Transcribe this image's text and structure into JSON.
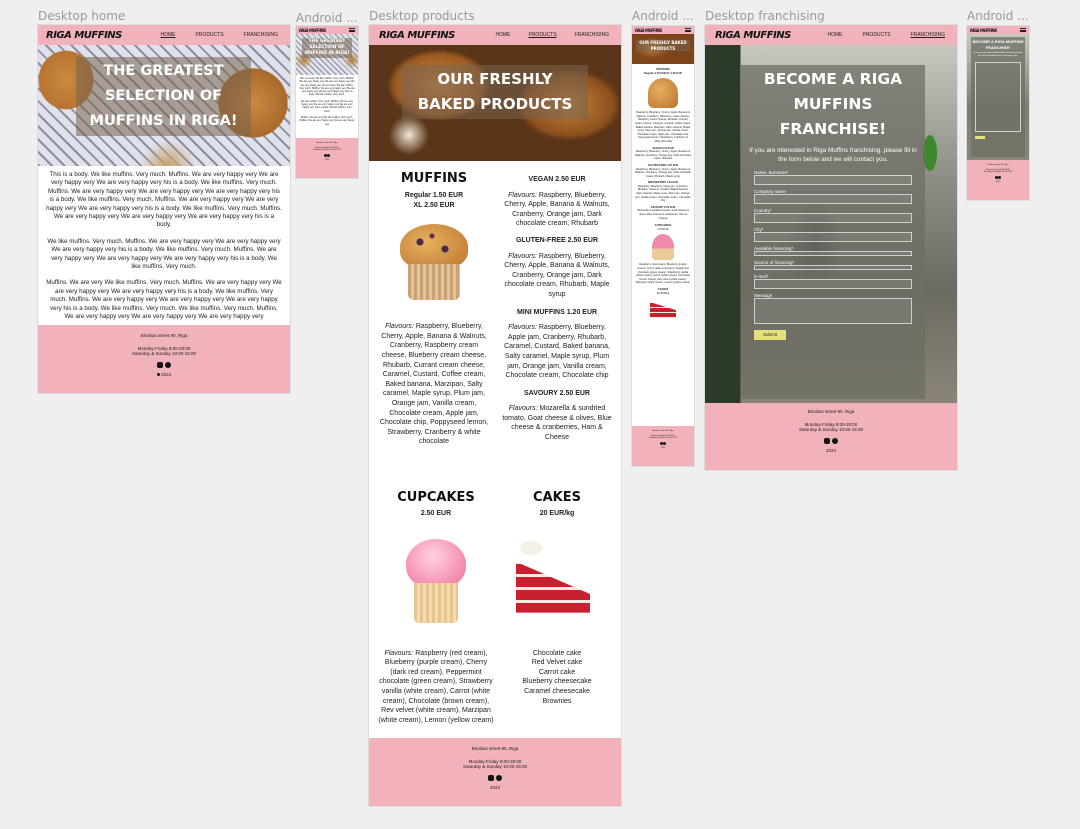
{
  "brand": "RIGA MUFFINS",
  "frames": {
    "desktop_home": "Desktop home",
    "android_home": "Android ...",
    "desktop_products": "Desktop products",
    "android_products": "Android ...",
    "desktop_franchising": "Desktop franchising",
    "android_franchising": "Android ..."
  },
  "nav": {
    "home": "HOME",
    "products": "PRODUCTS",
    "franchising": "FRANCHISING"
  },
  "home": {
    "hero_title": "THE GREATEST SELECTION OF MUFFINS IN RIGA!",
    "mobile_hero_title": "THE GREATEST SELECTION OF MUFFINS IN RIGA!",
    "p1": "This is a body. We like muffins. Very much. Muffins. We are very happy very We are very happy very We are very happy very   his is a body. We like muffins. Very much. Muffins. We are very happy very We are very happy very We are very happy very   his is a body. We like muffins. Very much. Muffins. We are very happy very We are very happy very We are very happy very   his is a body. We like muffins. Very much. Muffins. We are very happy very We are very happy very We are very happy very   his is a body.",
    "p2": "We like muffins. Very much. Muffins. We are very happy very We are very happy very We are very happy very   his is a body. We like muffins. Very much. Muffins. We are very happy very We are very happy very We are very happy very   his is a body. We like muffins. Very much.",
    "p3": "Muffins. We are very We like muffins. Very much. Muffins. We are very happy very We are very happy very We are very happy very   his is a body. We like muffins. Very much. Muffins. We are very happy very We are very happy very We are very happy very   his is a body. We like muffins. Very much. We like muffins. Very much. Muffins. We are very happy very We are very happy very We are very happy very",
    "m_p1": "This is a body. We like muffins. Very much. Muffins. We are very happy very We are very happy very We are very happy very   his is a body. We like muffins. Very much. Muffins. We are very happy very We are very happy very We are very happy very   his is a body. We like muffins. Very much.",
    "m_p2": "We like muffins. Very much. Muffins. We are very happy very We are very happy very We are very happy very   his is a body. We like muffins. Very much.",
    "m_p3": "Muffins. We are very We like muffins. Very much. Muffins. We are very happy very We are very happy very"
  },
  "footer": {
    "address": "Brivibas street 90, Riga",
    "hours1": "Monday-Friday 8:00-20:00",
    "hours2": "Saturday & Sunday 10:00-15:00",
    "copyright": "2023"
  },
  "products": {
    "hero_title": "OUR FRESHLY BAKED PRODUCTS",
    "muffins": {
      "title": "MUFFINS",
      "price1": "Regular 1.50 EUR",
      "price2": "XL 2.50 EUR",
      "flavours_label": "Flavours:",
      "flavours": "Raspberry, Blueberry, Cherry, Apple, Banana & Walnuts, Cranberry, Raspberry cream cheese, Blueberry cream cheese, Rhubarb, Currant cream cheese, Caramel, Custard, Coffee cream, Baked banana, Marzipan, Salty caramel, Maple syrup, Plum jam, Orange jam, Vanilla cream, Chocolate cream, Apple jam, Chocolate chip, Poppyseed lemon, Strawberry, Cranberry & white chocolate"
    },
    "vegan": {
      "title": "VEGAN 2.50 EUR",
      "flavours_label": "Flavours:",
      "flavours": "Raspberry, Blueberry, Cherry, Apple, Banana & Walnuts, Cranberry, Orange jam, Dark chocolate cream, Rhubarb"
    },
    "gluten": {
      "title": "GLUTEN-FREE 2.50 EUR",
      "flavours_label": "Flavours:",
      "flavours": "Raspberry, Blueberry, Cherry, Apple, Banana & Walnuts, Cranberry, Orange jam, Dark chocolate cream, Rhubarb, Maple syrup"
    },
    "mini": {
      "title": "MINI MUFFINS 1.20 EUR",
      "flavours_label": "Flavours:",
      "flavours": "Raspberry, Blueberry, Apple jam, Cranberry, Rhubarb, Caramel, Custard, Baked banana, Salty caramel, Maple syrup, Plum jam, Orange jam, Vanilla cream, Chocolate cream, Chocolate chip"
    },
    "savoury": {
      "title": "SAVOURY 2.50 EUR",
      "flavours_label": "Flavours:",
      "flavours": "Mozarella & sundried tomato, Goat cheese & olives, Blue cheese & cranberries, Ham & Cheese"
    },
    "cupcakes": {
      "title": "CUPCAKES",
      "price": "2.50 EUR",
      "flavours_label": "Flavours:",
      "flavours": "Raspberry (red cream), Blueberry (purple cream), Cherry (dark red cream), Peppermint chocolate (green cream), Strawberry vanilla (white cream), Carrot (white cream), Chocolate (brown cream), Rev velvet (white cream), Marzipan (white cream), Lemon (yellow cream)"
    },
    "cakes": {
      "title": "CAKES",
      "price": "20 EUR/kg",
      "list": [
        "Chocolate cake",
        "Red Velvet cake",
        "Carrot cake",
        "Blueberry cheesecake",
        "Caramel cheesecake",
        "Brownies"
      ]
    },
    "m": {
      "title": "OUR FRESHLY BAKED PRODUCTS",
      "muffins": "MUFFINS",
      "muffins_price": "Regular 1.50 EUR XL 2.50 EUR",
      "vegan": "VEGAN 2.50 EUR",
      "gluten": "GLUTEN-FREE 2.50 EUR",
      "mini": "MINI MUFFINS 1.20 EUR",
      "savoury": "SAVOURY 2.50 EUR",
      "cupcakes": "CUPCAKES",
      "cupcakes_price": "2.50 EUR",
      "cakes": "CAKES",
      "cakes_price": "20 EUR/kg"
    }
  },
  "franchise": {
    "hero_title": "BECOME A RIGA MUFFINS FRANCHISE!",
    "intro": "If you are interested in Riga Muffins franchising, please fill in the form below and we will contact you.",
    "labels": [
      "Name, Surname*",
      "Company name",
      "Country*",
      "City*",
      "Available financing*",
      "Source of financing*",
      "E-mail*",
      "Message"
    ],
    "submit": "Submit",
    "m_title": "BECOME A RIGA MUFFINS FRANCHISE!"
  },
  "colors": {
    "pink": "#f2b2bc",
    "submit": "#e6e07a"
  }
}
